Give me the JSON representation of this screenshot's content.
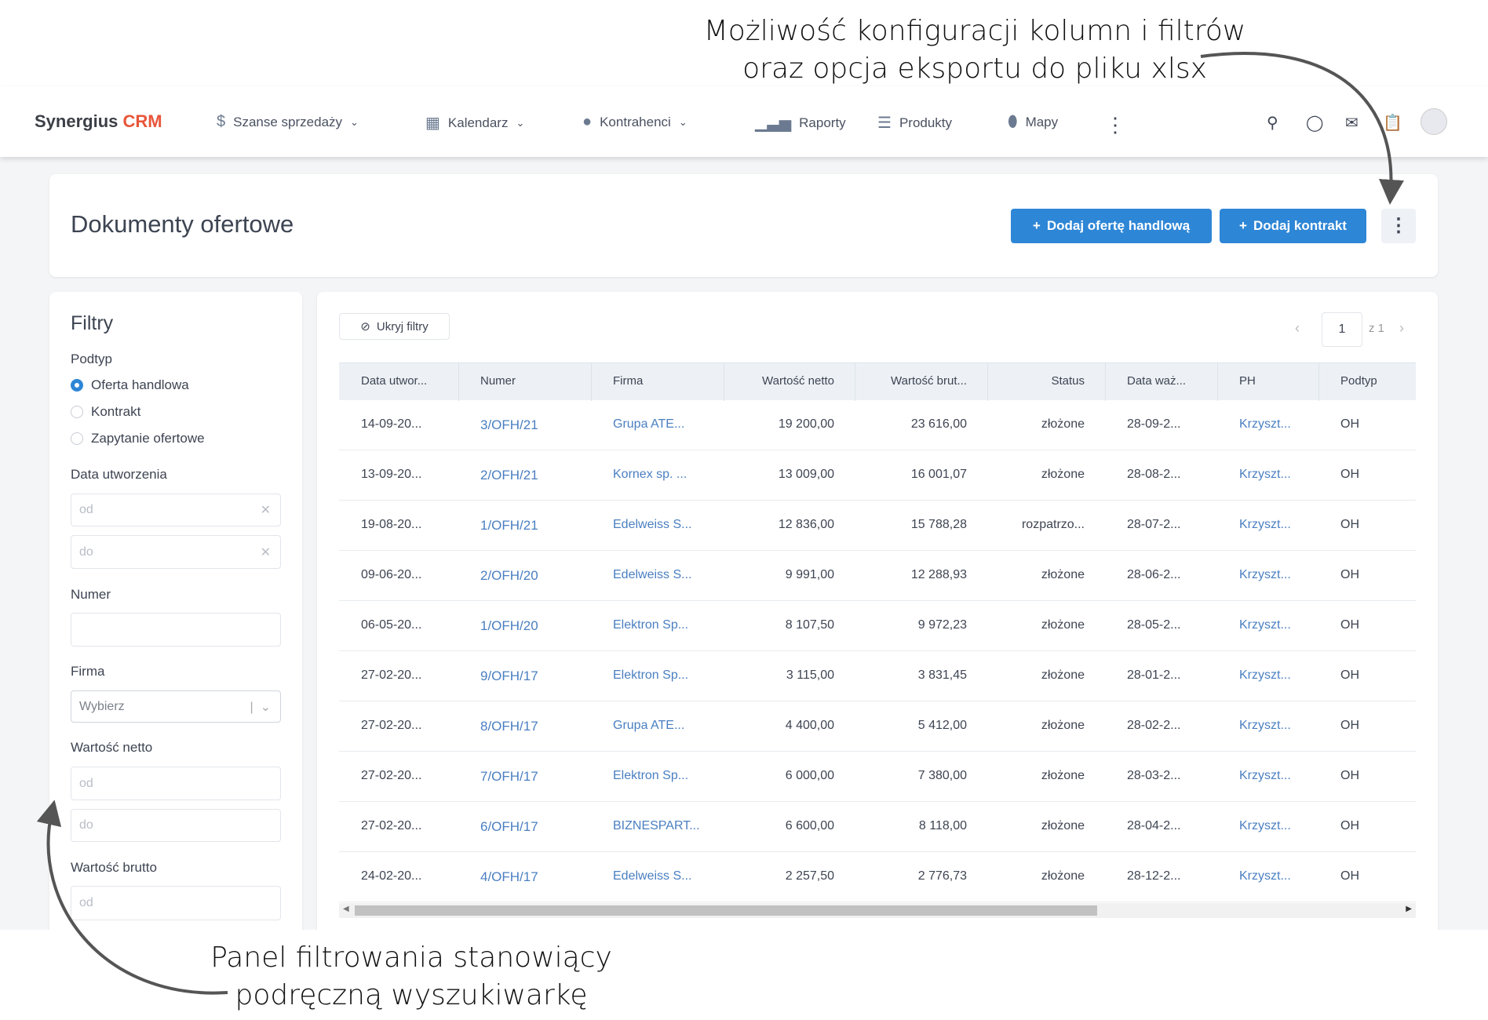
{
  "annotations": {
    "top_line1": "Możliwość konfiguracji kolumn i filtrów",
    "top_line2": "oraz opcja eksportu do pliku xlsx",
    "bottom_line1": "Panel filtrowania stanowiący",
    "bottom_line2": "podręczną wyszukiwarkę"
  },
  "nav": {
    "logo_main": "Synergius",
    "logo_accent": "CRM",
    "items": [
      {
        "label": "Szanse sprzedaży",
        "icon": "dollar-icon",
        "dropdown": true
      },
      {
        "label": "Kalendarz",
        "icon": "calendar-icon",
        "dropdown": true
      },
      {
        "label": "Kontrahenci",
        "icon": "user-icon",
        "dropdown": true
      },
      {
        "label": "Raporty",
        "icon": "signal-icon"
      },
      {
        "label": "Produkty",
        "icon": "list-icon"
      },
      {
        "label": "Mapy",
        "icon": "map-pin-icon"
      }
    ]
  },
  "header": {
    "title": "Dodaj",
    "page_title": "Dokumenty ofertowe",
    "add_offer": "Dodaj ofertę handlową",
    "add_contract": "Dodaj kontrakt"
  },
  "filters": {
    "title": "Filtry",
    "subtype_label": "Podtyp",
    "subtypes": [
      "Oferta handlowa",
      "Kontrakt",
      "Zapytanie ofertowe"
    ],
    "subtype_selected": 0,
    "created_label": "Data utworzenia",
    "from_placeholder": "od",
    "to_placeholder": "do",
    "number_label": "Numer",
    "company_label": "Firma",
    "company_placeholder": "Wybierz",
    "net_label": "Wartość netto",
    "gross_label": "Wartość brutto"
  },
  "table": {
    "hide_filters": "Ukryj filtry",
    "page": "1",
    "page_of": "z 1",
    "columns": [
      "Data utwor...",
      "Numer",
      "Firma",
      "Wartość netto",
      "Wartość brut...",
      "Status",
      "Data waż...",
      "PH",
      "Podtyp"
    ],
    "rows": [
      [
        "14-09-20...",
        "3/OFH/21",
        "Grupa ATE...",
        "19 200,00",
        "23 616,00",
        "złożone",
        "28-09-2...",
        "Krzyszt...",
        "OH"
      ],
      [
        "13-09-20...",
        "2/OFH/21",
        "Kornex sp. ...",
        "13 009,00",
        "16 001,07",
        "złożone",
        "28-08-2...",
        "Krzyszt...",
        "OH"
      ],
      [
        "19-08-20...",
        "1/OFH/21",
        "Edelweiss S...",
        "12 836,00",
        "15 788,28",
        "rozpatrzo...",
        "28-07-2...",
        "Krzyszt...",
        "OH"
      ],
      [
        "09-06-20...",
        "2/OFH/20",
        "Edelweiss S...",
        "9 991,00",
        "12 288,93",
        "złożone",
        "28-06-2...",
        "Krzyszt...",
        "OH"
      ],
      [
        "06-05-20...",
        "1/OFH/20",
        "Elektron Sp...",
        "8 107,50",
        "9 972,23",
        "złożone",
        "28-05-2...",
        "Krzyszt...",
        "OH"
      ],
      [
        "27-02-20...",
        "9/OFH/17",
        "Elektron Sp...",
        "3 115,00",
        "3 831,45",
        "złożone",
        "28-01-2...",
        "Krzyszt...",
        "OH"
      ],
      [
        "27-02-20...",
        "8/OFH/17",
        "Grupa ATE...",
        "4 400,00",
        "5 412,00",
        "złożone",
        "28-02-2...",
        "Krzyszt...",
        "OH"
      ],
      [
        "27-02-20...",
        "7/OFH/17",
        "Elektron Sp...",
        "6 000,00",
        "7 380,00",
        "złożone",
        "28-03-2...",
        "Krzyszt...",
        "OH"
      ],
      [
        "27-02-20...",
        "6/OFH/17",
        "BIZNESPART...",
        "6 600,00",
        "8 118,00",
        "złożone",
        "28-04-2...",
        "Krzyszt...",
        "OH"
      ],
      [
        "24-02-20...",
        "4/OFH/17",
        "Edelweiss S...",
        "2 257,50",
        "2 776,73",
        "złożone",
        "28-12-2...",
        "Krzyszt...",
        "OH"
      ]
    ]
  },
  "colors": {
    "accent": "#2e86d6",
    "logo_accent": "#e8553a",
    "link": "#4a7fc1"
  }
}
